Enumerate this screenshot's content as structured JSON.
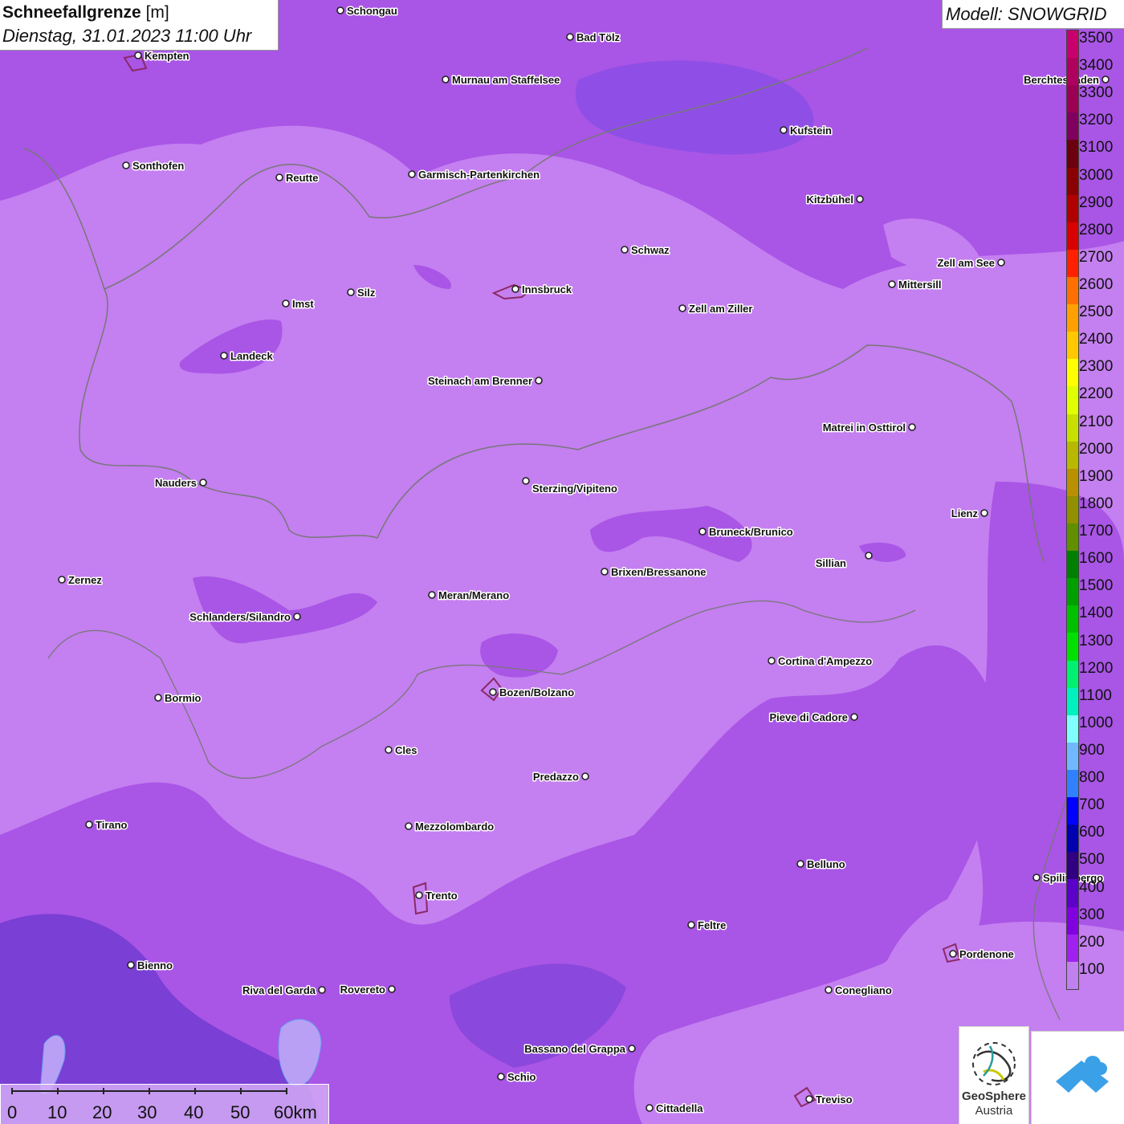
{
  "title": {
    "main": "Schneefallgrenze",
    "unit": "[m]",
    "datetime": "Dienstag, 31.01.2023 11:00 Uhr"
  },
  "model": {
    "label": "Modell: SNOWGRID"
  },
  "colors": {
    "dominant_field": "#c47ff0",
    "low_field": "#a955e6",
    "deep_low": "#7a3fd4"
  },
  "legend": {
    "ticks": [
      "3500",
      "3400",
      "3300",
      "3200",
      "3100",
      "3000",
      "2900",
      "2800",
      "2700",
      "2600",
      "2500",
      "2400",
      "2300",
      "2200",
      "2100",
      "2000",
      "1900",
      "1800",
      "1700",
      "1600",
      "1500",
      "1400",
      "1300",
      "1200",
      "1100",
      "1000",
      "900",
      "800",
      "700",
      "600",
      "500",
      "400",
      "300",
      "200",
      "100"
    ],
    "colors": [
      "#c8006e",
      "#b0005f",
      "#9c0055",
      "#800060",
      "#6a0010",
      "#8a0000",
      "#b00000",
      "#d80000",
      "#ff2000",
      "#ff7000",
      "#ffa000",
      "#ffc800",
      "#ffff00",
      "#e0ff00",
      "#c8e000",
      "#b8b800",
      "#b89000",
      "#909000",
      "#609000",
      "#008000",
      "#00a000",
      "#00c000",
      "#00e000",
      "#00f070",
      "#00f0c0",
      "#80ffff",
      "#70b8ff",
      "#3080ff",
      "#0000ff",
      "#0000b0",
      "#300080",
      "#5a00c8",
      "#8000e0",
      "#a020f0",
      "#c080f0"
    ]
  },
  "cities": [
    {
      "name": "Schongau"
    },
    {
      "name": "Bad Tölz"
    },
    {
      "name": "Kempten"
    },
    {
      "name": "Murnau am Staffelsee"
    },
    {
      "name": "Berchtesgaden"
    },
    {
      "name": "Kufstein"
    },
    {
      "name": "Sonthofen"
    },
    {
      "name": "Reutte"
    },
    {
      "name": "Garmisch-Partenkirchen"
    },
    {
      "name": "Kitzbühel"
    },
    {
      "name": "Schwaz"
    },
    {
      "name": "Zell am See"
    },
    {
      "name": "Innsbruck"
    },
    {
      "name": "Mittersill"
    },
    {
      "name": "Imst"
    },
    {
      "name": "Silz"
    },
    {
      "name": "Zell am Ziller"
    },
    {
      "name": "Landeck"
    },
    {
      "name": "Steinach am Brenner"
    },
    {
      "name": "Matrei in Osttirol"
    },
    {
      "name": "Nauders"
    },
    {
      "name": "Sterzing/Vipiteno"
    },
    {
      "name": "Lienz"
    },
    {
      "name": "Bruneck/Brunico"
    },
    {
      "name": "Sillian"
    },
    {
      "name": "Zernez"
    },
    {
      "name": "Brixen/Bressanone"
    },
    {
      "name": "Meran/Merano"
    },
    {
      "name": "Schlanders/Silandro"
    },
    {
      "name": "Cortina d'Ampezzo"
    },
    {
      "name": "Bozen/Bolzano"
    },
    {
      "name": "Bormio"
    },
    {
      "name": "Pieve di Cadore"
    },
    {
      "name": "Cles"
    },
    {
      "name": "Predazzo"
    },
    {
      "name": "Tirano"
    },
    {
      "name": "Mezzolombardo"
    },
    {
      "name": "Belluno"
    },
    {
      "name": "Spilimbergo"
    },
    {
      "name": "Trento"
    },
    {
      "name": "Feltre"
    },
    {
      "name": "Pordenone"
    },
    {
      "name": "Bienno"
    },
    {
      "name": "Riva del Garda"
    },
    {
      "name": "Rovereto"
    },
    {
      "name": "Conegliano"
    },
    {
      "name": "Bassano del Grappa"
    },
    {
      "name": "Schio"
    },
    {
      "name": "Treviso"
    },
    {
      "name": "Cittadella"
    }
  ],
  "scale": {
    "ticks": [
      "0",
      "10",
      "20",
      "30",
      "40",
      "50",
      "60km"
    ]
  },
  "logo": {
    "line1": "GeoSphere",
    "line2": "Austria"
  }
}
